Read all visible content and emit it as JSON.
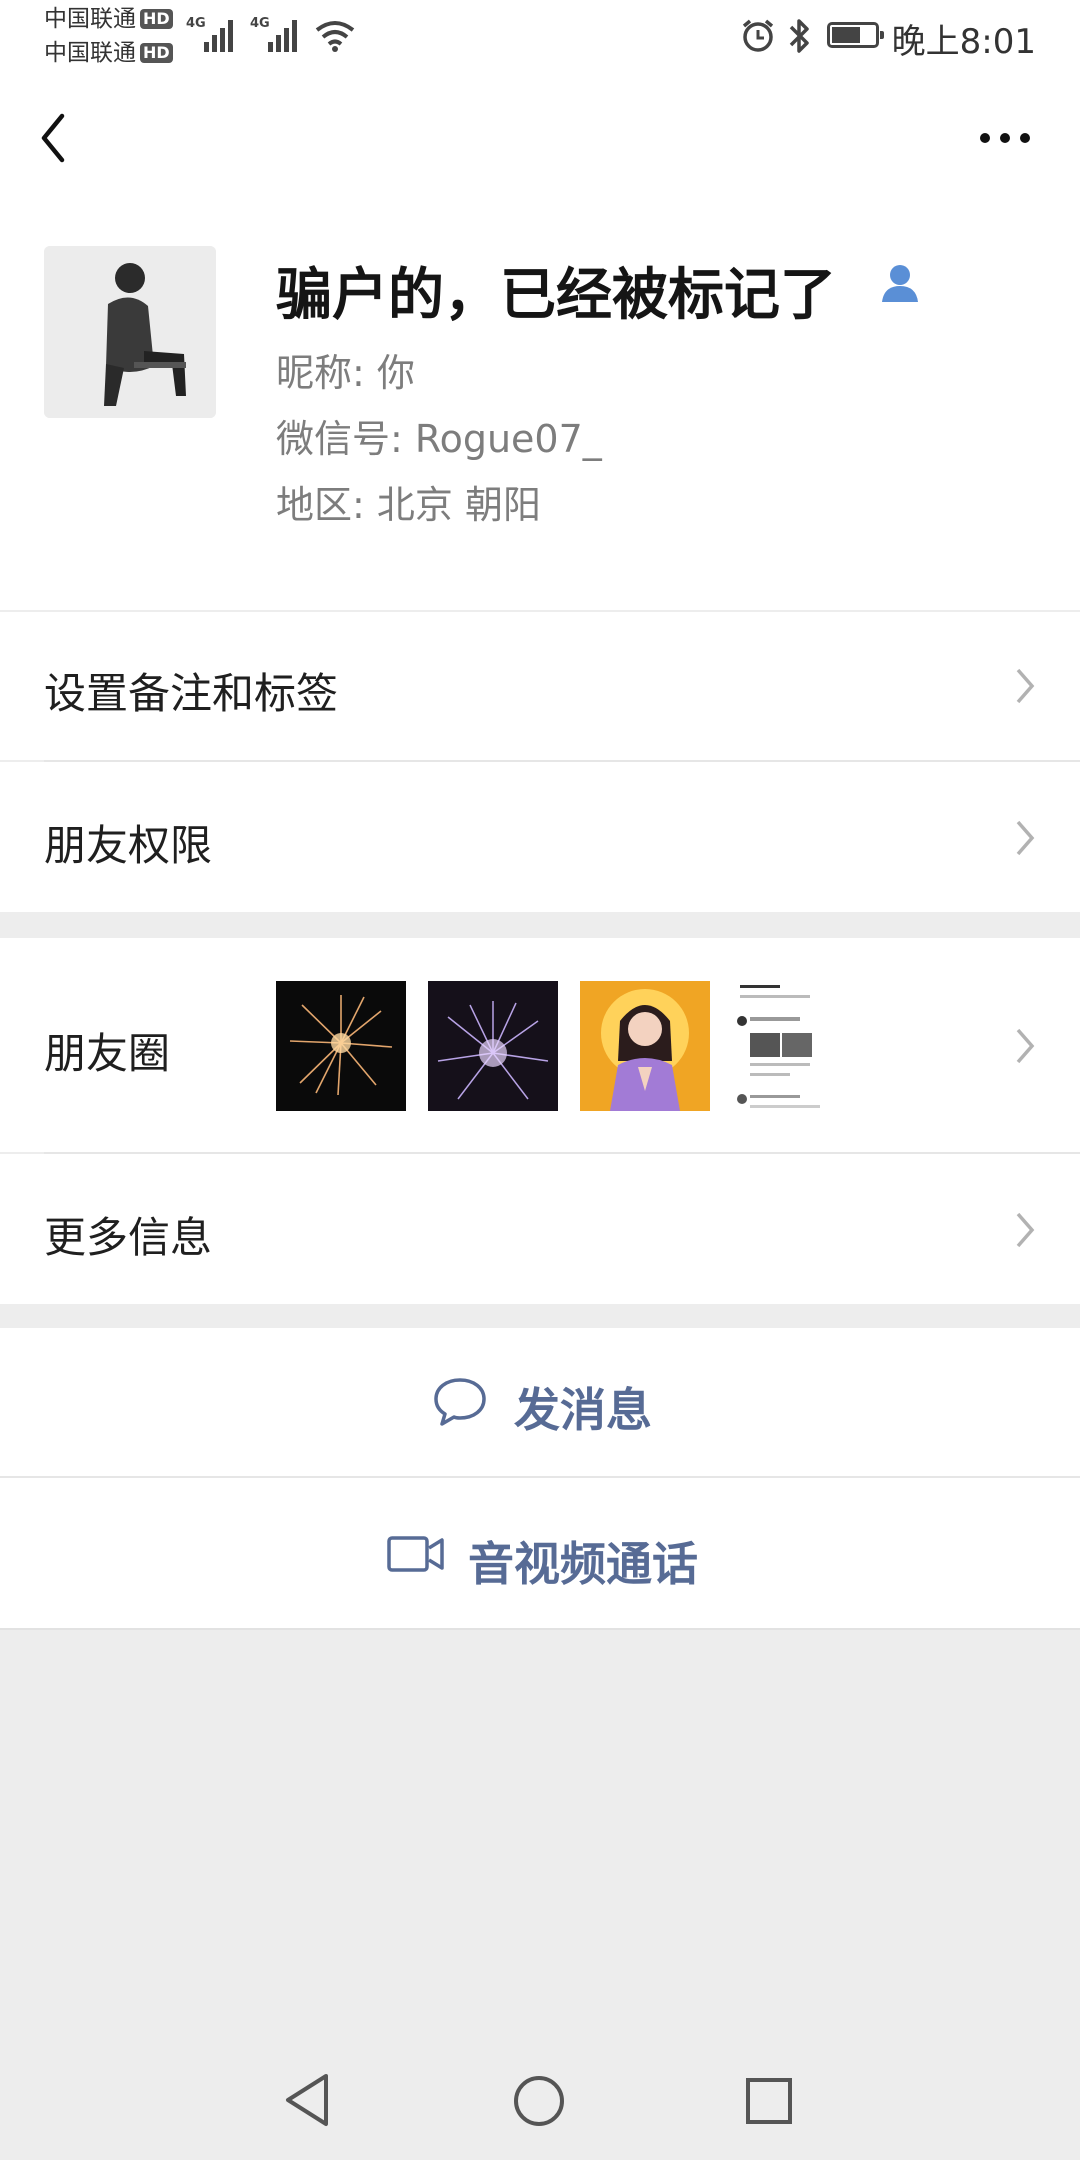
{
  "status_bar": {
    "carrier1": "中国联通",
    "carrier2": "中国联通",
    "hd": "HD",
    "network": "4G",
    "time": "晚上8:01"
  },
  "profile": {
    "name": "骗户的，已经被标记了",
    "nickname": "昵称: 你",
    "wechat_id": "微信号: Rogue07_",
    "region": "地区: 北京  朝阳"
  },
  "menu": {
    "remark": "设置备注和标签",
    "permissions": "朋友权限",
    "moments": "朋友圈",
    "more_info": "更多信息"
  },
  "actions": {
    "message": "发消息",
    "call": "音视频通话"
  },
  "colors": {
    "link": "#576b95",
    "background": "#ededed",
    "contact_icon": "#5a8fd6"
  }
}
